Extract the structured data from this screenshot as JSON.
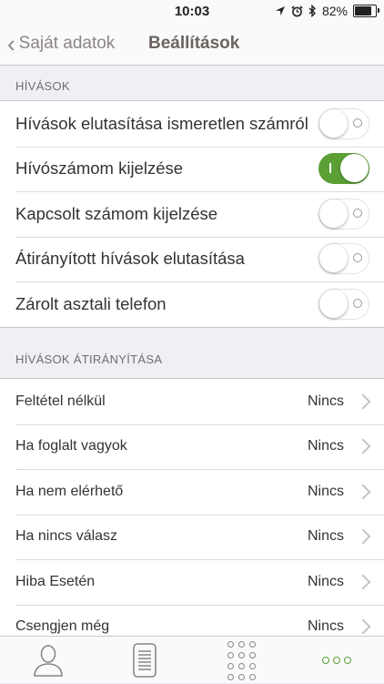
{
  "status": {
    "time": "10:03",
    "battery_percent": "82%",
    "battery_level": 0.82
  },
  "nav": {
    "back_label": "Saját adatok",
    "title": "Beállítások"
  },
  "calls_section": {
    "header": "HÍVÁSOK",
    "items": [
      {
        "label": "Hívások elutasítása ismeretlen számról",
        "on": false
      },
      {
        "label": "Hívószámom kijelzése",
        "on": true
      },
      {
        "label": "Kapcsolt számom kijelzése",
        "on": false
      },
      {
        "label": "Átirányított hívások elutasítása",
        "on": false
      },
      {
        "label": "Zárolt asztali telefon",
        "on": false
      }
    ]
  },
  "forward_section": {
    "header": "HÍVÁSOK ÁTIRÁNYÍTÁSA",
    "items": [
      {
        "label": "Feltétel nélkül",
        "value": "Nincs"
      },
      {
        "label": "Ha foglalt vagyok",
        "value": "Nincs"
      },
      {
        "label": "Ha nem elérhető",
        "value": "Nincs"
      },
      {
        "label": "Ha nincs válasz",
        "value": "Nincs"
      },
      {
        "label": "Hiba Esetén",
        "value": "Nincs"
      },
      {
        "label": "Csengjen még",
        "value": "Nincs"
      }
    ]
  },
  "colors": {
    "accent": "#5b9f35",
    "nav_text": "#6b6461",
    "background": "#efeff4"
  },
  "tabbar": {
    "tabs": [
      "contacts-icon",
      "call-log-icon",
      "dialpad-icon",
      "more-icon"
    ],
    "active": "more-icon"
  }
}
